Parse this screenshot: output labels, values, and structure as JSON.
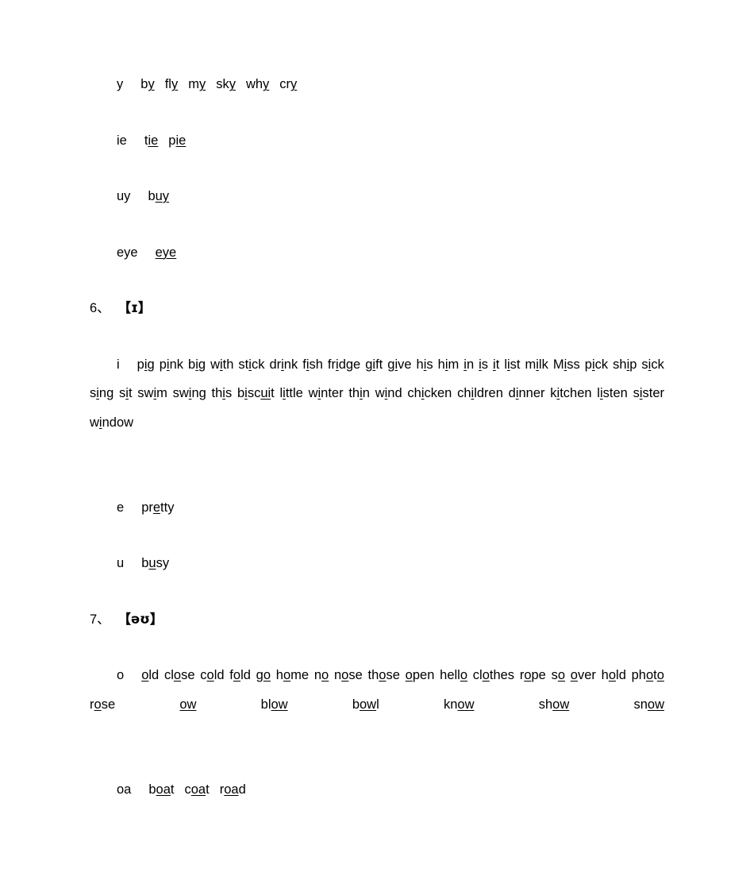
{
  "document": {
    "type": "english-phonics-worksheet",
    "sections": [
      {
        "id": "ai-tail-rows",
        "rows": [
          {
            "label": "y",
            "words": [
              {
                "pre": "b",
                "mid": "y",
                "post": ""
              },
              {
                "pre": "fl",
                "mid": "y",
                "post": ""
              },
              {
                "pre": "m",
                "mid": "y",
                "post": ""
              },
              {
                "pre": "sk",
                "mid": "y",
                "post": ""
              },
              {
                "pre": "wh",
                "mid": "y",
                "post": ""
              },
              {
                "pre": "cr",
                "mid": "y",
                "post": ""
              }
            ]
          },
          {
            "label": "ie",
            "words": [
              {
                "pre": "t",
                "mid": "ie",
                "post": ""
              },
              {
                "pre": "p",
                "mid": "ie",
                "post": ""
              }
            ]
          },
          {
            "label": "uy",
            "words": [
              {
                "pre": "b",
                "mid": "uy",
                "post": ""
              }
            ]
          },
          {
            "label": "eye",
            "words": [
              {
                "pre": "",
                "mid": "eye",
                "post": ""
              }
            ]
          }
        ]
      },
      {
        "id": "section-6",
        "heading": {
          "number": "6、",
          "ipa": "【ɪ】"
        },
        "main_label": "i",
        "main_words": [
          {
            "pre": "p",
            "mid": "i",
            "post": "g"
          },
          {
            "pre": "p",
            "mid": "i",
            "post": "nk"
          },
          {
            "pre": "b",
            "mid": "i",
            "post": "g"
          },
          {
            "pre": "w",
            "mid": "i",
            "post": "th"
          },
          {
            "pre": "st",
            "mid": "i",
            "post": "ck"
          },
          {
            "pre": "dr",
            "mid": "i",
            "post": "nk"
          },
          {
            "pre": "f",
            "mid": "i",
            "post": "sh"
          },
          {
            "pre": "fr",
            "mid": "i",
            "post": "dge"
          },
          {
            "pre": "g",
            "mid": "i",
            "post": "ft"
          },
          {
            "pre": "g",
            "mid": "i",
            "post": "ve"
          },
          {
            "pre": "h",
            "mid": "i",
            "post": "s"
          },
          {
            "pre": "h",
            "mid": "i",
            "post": "m"
          },
          {
            "pre": "",
            "mid": "i",
            "post": "n"
          },
          {
            "pre": "",
            "mid": "i",
            "post": "s"
          },
          {
            "pre": "",
            "mid": "i",
            "post": "t"
          },
          {
            "pre": "l",
            "mid": "i",
            "post": "st"
          },
          {
            "pre": "m",
            "mid": "i",
            "post": "lk"
          },
          {
            "pre": "M",
            "mid": "i",
            "post": "ss"
          },
          {
            "pre": "p",
            "mid": "i",
            "post": "ck"
          },
          {
            "pre": "sh",
            "mid": "i",
            "post": "p"
          },
          {
            "pre": "s",
            "mid": "i",
            "post": "ck"
          },
          {
            "pre": "s",
            "mid": "i",
            "post": "ng"
          },
          {
            "pre": "s",
            "mid": "i",
            "post": "t"
          },
          {
            "pre": "sw",
            "mid": "i",
            "post": "m"
          },
          {
            "pre": "sw",
            "mid": "i",
            "post": "ng"
          },
          {
            "pre": "th",
            "mid": "i",
            "post": "s"
          },
          {
            "pre": "b",
            "mid": "i",
            "post": "sc",
            "mid2": "ui",
            "post2": "t"
          },
          {
            "pre": "l",
            "mid": "i",
            "post": "ttle"
          },
          {
            "pre": "w",
            "mid": "i",
            "post": "nter"
          },
          {
            "pre": "th",
            "mid": "i",
            "post": "n"
          },
          {
            "pre": "w",
            "mid": "i",
            "post": "nd"
          },
          {
            "pre": "ch",
            "mid": "i",
            "post": "cken"
          },
          {
            "pre": "ch",
            "mid": "i",
            "post": "ldren"
          },
          {
            "pre": "d",
            "mid": "i",
            "post": "nner"
          },
          {
            "pre": "k",
            "mid": "i",
            "post": "tchen"
          },
          {
            "pre": "l",
            "mid": "i",
            "post": "sten"
          },
          {
            "pre": "s",
            "mid": "i",
            "post": "ster"
          },
          {
            "pre": "w",
            "mid": "i",
            "post": "ndow"
          }
        ],
        "extra_rows": [
          {
            "label": "e",
            "words": [
              {
                "pre": "pr",
                "mid": "e",
                "post": "tty"
              }
            ]
          },
          {
            "label": "u",
            "words": [
              {
                "pre": "b",
                "mid": "u",
                "post": "sy"
              }
            ]
          }
        ]
      },
      {
        "id": "section-7",
        "heading": {
          "number": "7、",
          "ipa": "【əʊ】"
        },
        "main_label": "o",
        "main_words": [
          {
            "pre": "",
            "mid": "o",
            "post": "ld"
          },
          {
            "pre": "cl",
            "mid": "o",
            "post": "se"
          },
          {
            "pre": "c",
            "mid": "o",
            "post": "ld"
          },
          {
            "pre": "f",
            "mid": "o",
            "post": "ld"
          },
          {
            "pre": "g",
            "mid": "o",
            "post": ""
          },
          {
            "pre": "h",
            "mid": "o",
            "post": "me"
          },
          {
            "pre": "n",
            "mid": "o",
            "post": ""
          },
          {
            "pre": "n",
            "mid": "o",
            "post": "se"
          },
          {
            "pre": "th",
            "mid": "o",
            "post": "se"
          },
          {
            "pre": "",
            "mid": "o",
            "post": "pen"
          },
          {
            "pre": "hell",
            "mid": "o",
            "post": ""
          },
          {
            "pre": "cl",
            "mid": "o",
            "post": "thes"
          },
          {
            "pre": "r",
            "mid": "o",
            "post": "pe"
          },
          {
            "pre": "s",
            "mid": "o",
            "post": ""
          },
          {
            "pre": "",
            "mid": "o",
            "post": "ver"
          },
          {
            "pre": "h",
            "mid": "o",
            "post": "ld"
          },
          {
            "pre": "ph",
            "mid": "o",
            "post": "t",
            "mid2": "o",
            "post2": ""
          },
          {
            "pre": "r",
            "mid": "o",
            "post": "se"
          },
          {
            "pre": "",
            "mid": "ow",
            "post": ""
          },
          {
            "pre": "bl",
            "mid": "ow",
            "post": ""
          },
          {
            "pre": "b",
            "mid": "ow",
            "post": "l"
          },
          {
            "pre": "kn",
            "mid": "ow",
            "post": ""
          },
          {
            "pre": "sh",
            "mid": "ow",
            "post": ""
          },
          {
            "pre": "sn",
            "mid": "ow",
            "post": ""
          }
        ],
        "extra_rows": [
          {
            "label": "oa",
            "words": [
              {
                "pre": "b",
                "mid": "oa",
                "post": "t"
              },
              {
                "pre": "c",
                "mid": "oa",
                "post": "t"
              },
              {
                "pre": "r",
                "mid": "oa",
                "post": "d"
              }
            ]
          }
        ]
      }
    ]
  }
}
